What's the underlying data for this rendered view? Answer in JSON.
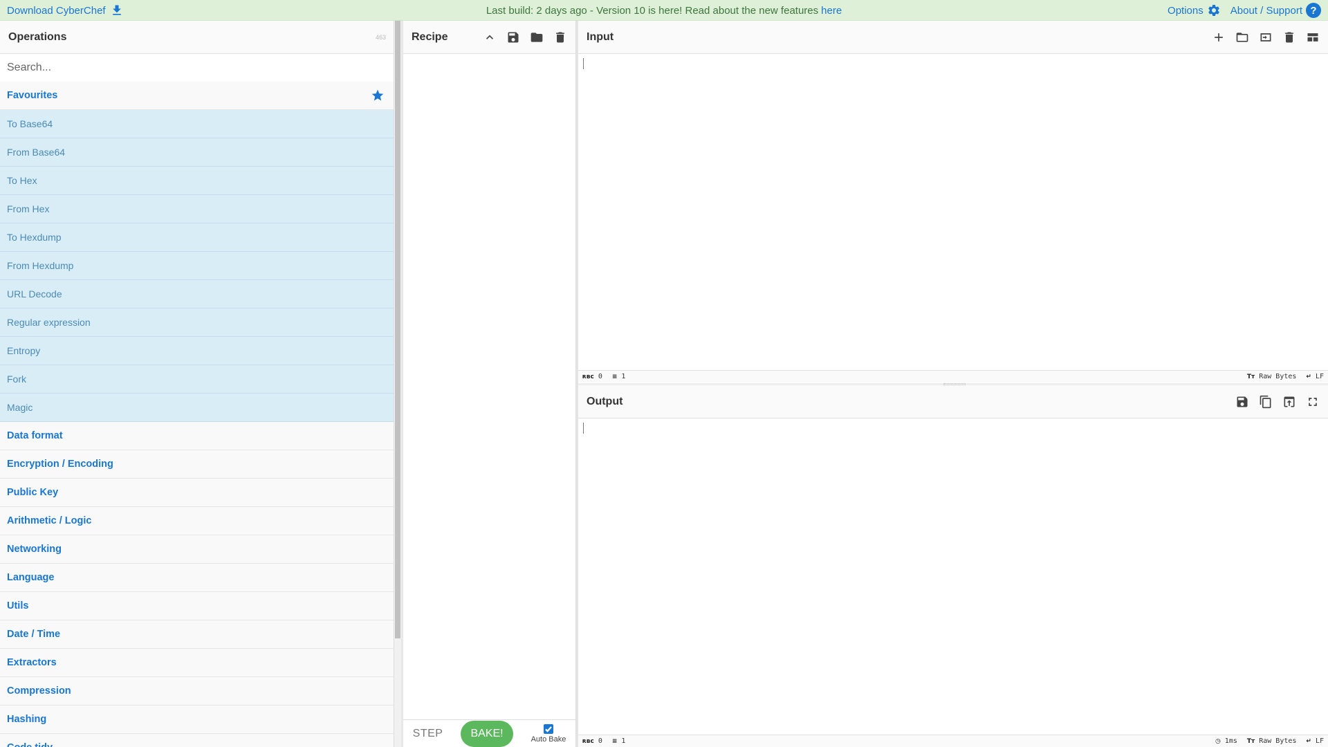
{
  "banner": {
    "download_label": "Download CyberChef",
    "build_text": "Last build: 2 days ago - Version 10 is here! Read about the new features",
    "build_link": "here",
    "options_label": "Options",
    "about_label": "About / Support"
  },
  "operations": {
    "title": "Operations",
    "count": "463",
    "search_placeholder": "Search...",
    "favourites_label": "Favourites",
    "favourite_ops": [
      "To Base64",
      "From Base64",
      "To Hex",
      "From Hex",
      "To Hexdump",
      "From Hexdump",
      "URL Decode",
      "Regular expression",
      "Entropy",
      "Fork",
      "Magic"
    ],
    "categories": [
      "Data format",
      "Encryption / Encoding",
      "Public Key",
      "Arithmetic / Logic",
      "Networking",
      "Language",
      "Utils",
      "Date / Time",
      "Extractors",
      "Compression",
      "Hashing",
      "Code tidy"
    ]
  },
  "recipe": {
    "title": "Recipe",
    "step_label": "STEP",
    "bake_label": "BAKE!",
    "autobake_label": "Auto Bake",
    "autobake_checked": true
  },
  "input": {
    "title": "Input",
    "status": {
      "length": "0",
      "lines": "1",
      "encoding": "Raw Bytes",
      "eol": "LF"
    }
  },
  "output": {
    "title": "Output",
    "status": {
      "time": "1ms",
      "length": "0",
      "lines": "1",
      "encoding": "Raw Bytes",
      "eol": "LF"
    }
  },
  "colors": {
    "accent": "#1976d2",
    "banner_bg": "#dff0d8",
    "favourite_row_bg": "#d9edf7",
    "bake_button": "#5cb85c"
  }
}
